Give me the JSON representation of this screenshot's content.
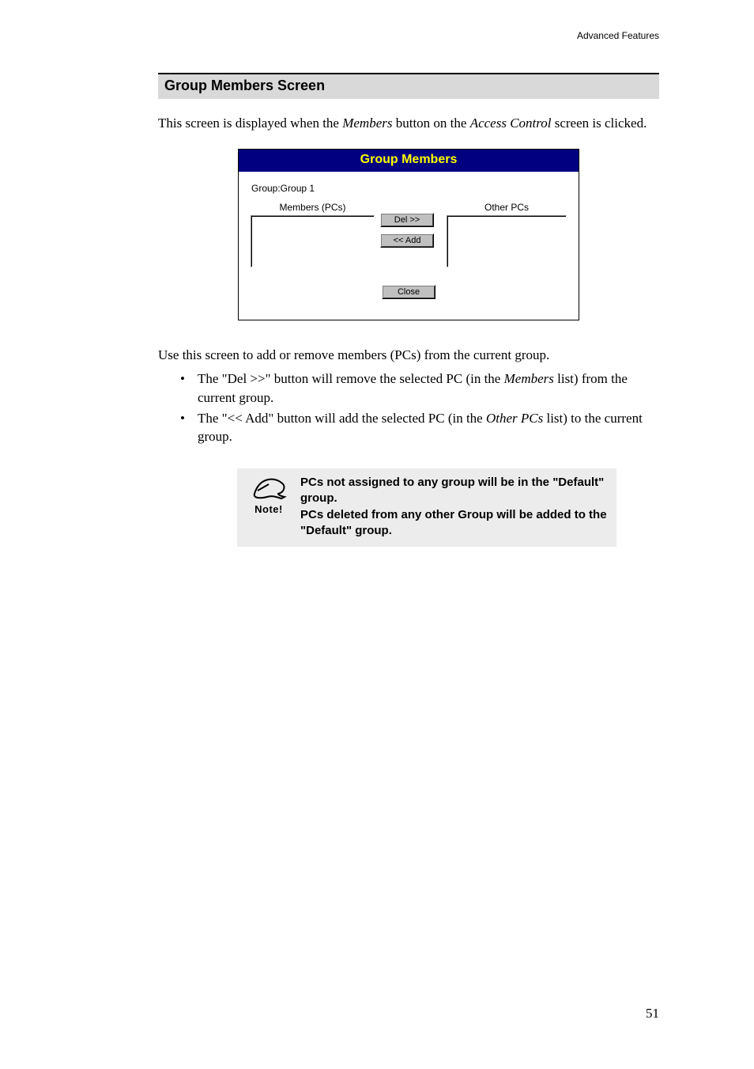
{
  "header": {
    "running": "Advanced Features"
  },
  "section": {
    "title": "Group Members Screen"
  },
  "intro": {
    "pre": "This screen is displayed when the ",
    "em1": "Members",
    "mid": " button on the ",
    "em2": "Access Control",
    "post": " screen is clicked."
  },
  "figure": {
    "title": "Group Members",
    "group_label": "Group:Group 1",
    "members_label": "Members (PCs)",
    "others_label": "Other PCs",
    "btn_del": "Del >>",
    "btn_add": "<< Add",
    "btn_close": "Close"
  },
  "desc_lead": "Use this screen to add or remove members (PCs) from the current group.",
  "bullets": [
    {
      "a": "The \"Del >>\" button will remove the selected PC (in the ",
      "em": "Members",
      "b": " list) from the current group."
    },
    {
      "a": "The \"<< Add\" button will add the selected PC (in the ",
      "em": "Other PCs",
      "b": " list) to the current group."
    }
  ],
  "note": {
    "label": "Note!",
    "line1": "PCs not assigned to any group will be in the \"Default\" group.",
    "line2": "PCs deleted from any other Group will be added to the \"Default\" group."
  },
  "page_number": "51"
}
